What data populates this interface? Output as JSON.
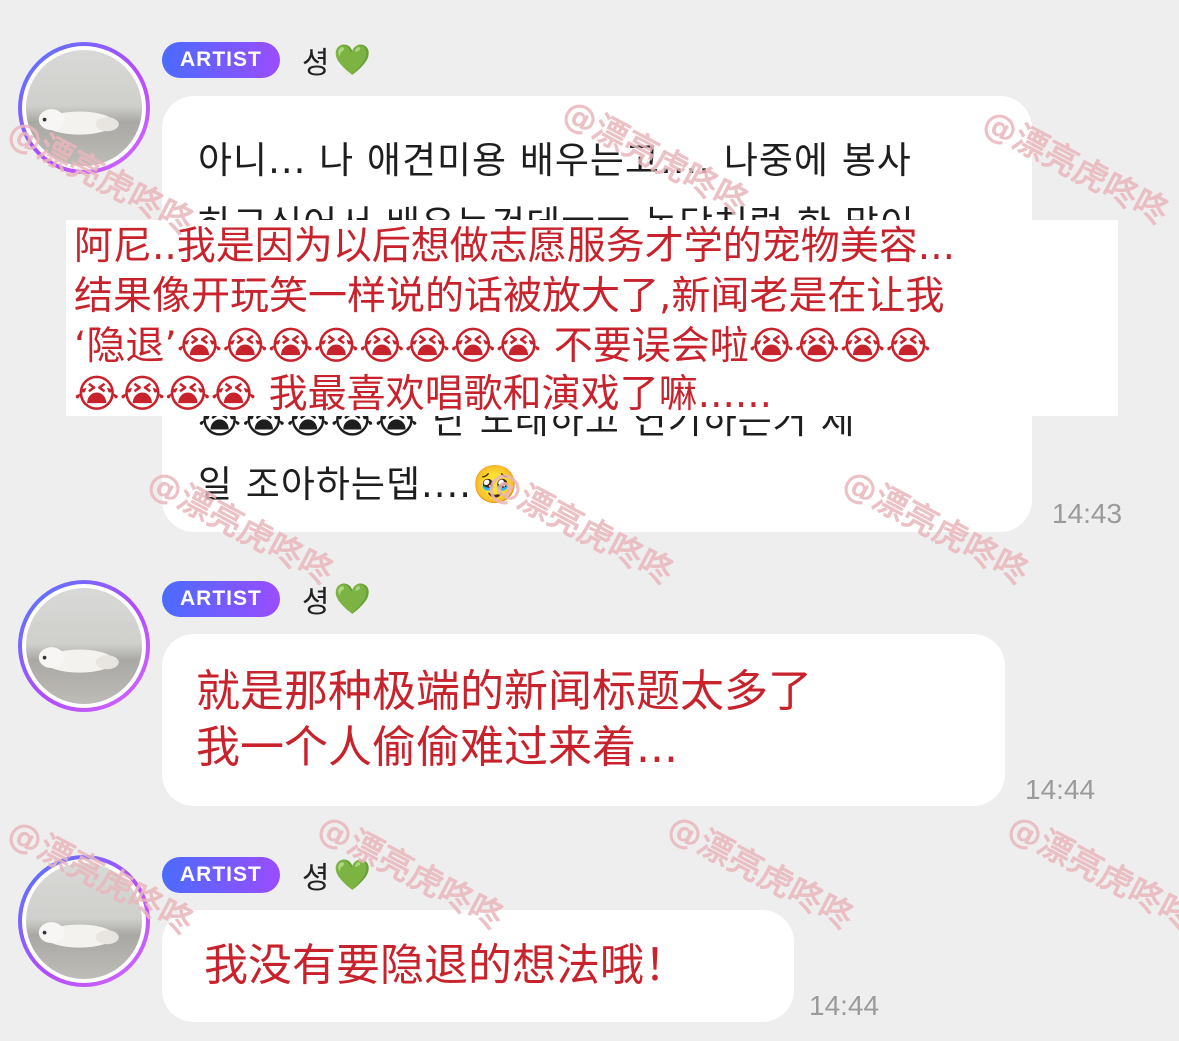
{
  "messages": [
    {
      "badge": "ARTIST",
      "sender": "셩",
      "heart": "💚",
      "korean_lines": [
        "아니... 나 애견미용 배우는고.... 나중에 봉사",
        "하고싶어서 배우는건데ㅠㅠ 농담처럼 한 말이",
        "😭😭😭😭😭 난 노래하고 연기하는거 제",
        "일 조아하는뎁....🥹"
      ],
      "translation_lines": [
        "阿尼..我是因为以后想做志愿服务才学的宠物美容...",
        "结果像开玩笑一样说的话被放大了,新闻老是在让我",
        "‘隐退’😭😭😭😭😭😭😭😭 不要误会啦😭😭😭😭",
        "😭😭😭😭 我最喜欢唱歌和演戏了嘛......"
      ],
      "time": "14:43"
    },
    {
      "badge": "ARTIST",
      "sender": "셩",
      "heart": "💚",
      "translation_lines": [
        "就是那种极端的新闻标题太多了",
        "我一个人偷偷难过来着..."
      ],
      "time": "14:44"
    },
    {
      "badge": "ARTIST",
      "sender": "셩",
      "heart": "💚",
      "translation_lines": [
        "我没有要隐退的想法哦！"
      ],
      "time": "14:44"
    }
  ],
  "watermark": "@漂亮虎咚咚",
  "colors": {
    "background": "#eeeeee",
    "bubble": "#ffffff",
    "translation_text": "#c8232c",
    "badge_start": "#4b6bff",
    "badge_end": "#9a4dff",
    "avatar_ring": "#b24bff",
    "watermark": "#e9b7bd"
  },
  "icons": {
    "avatar": "sleeping-dog-photo",
    "heart": "green-heart-emoji"
  }
}
